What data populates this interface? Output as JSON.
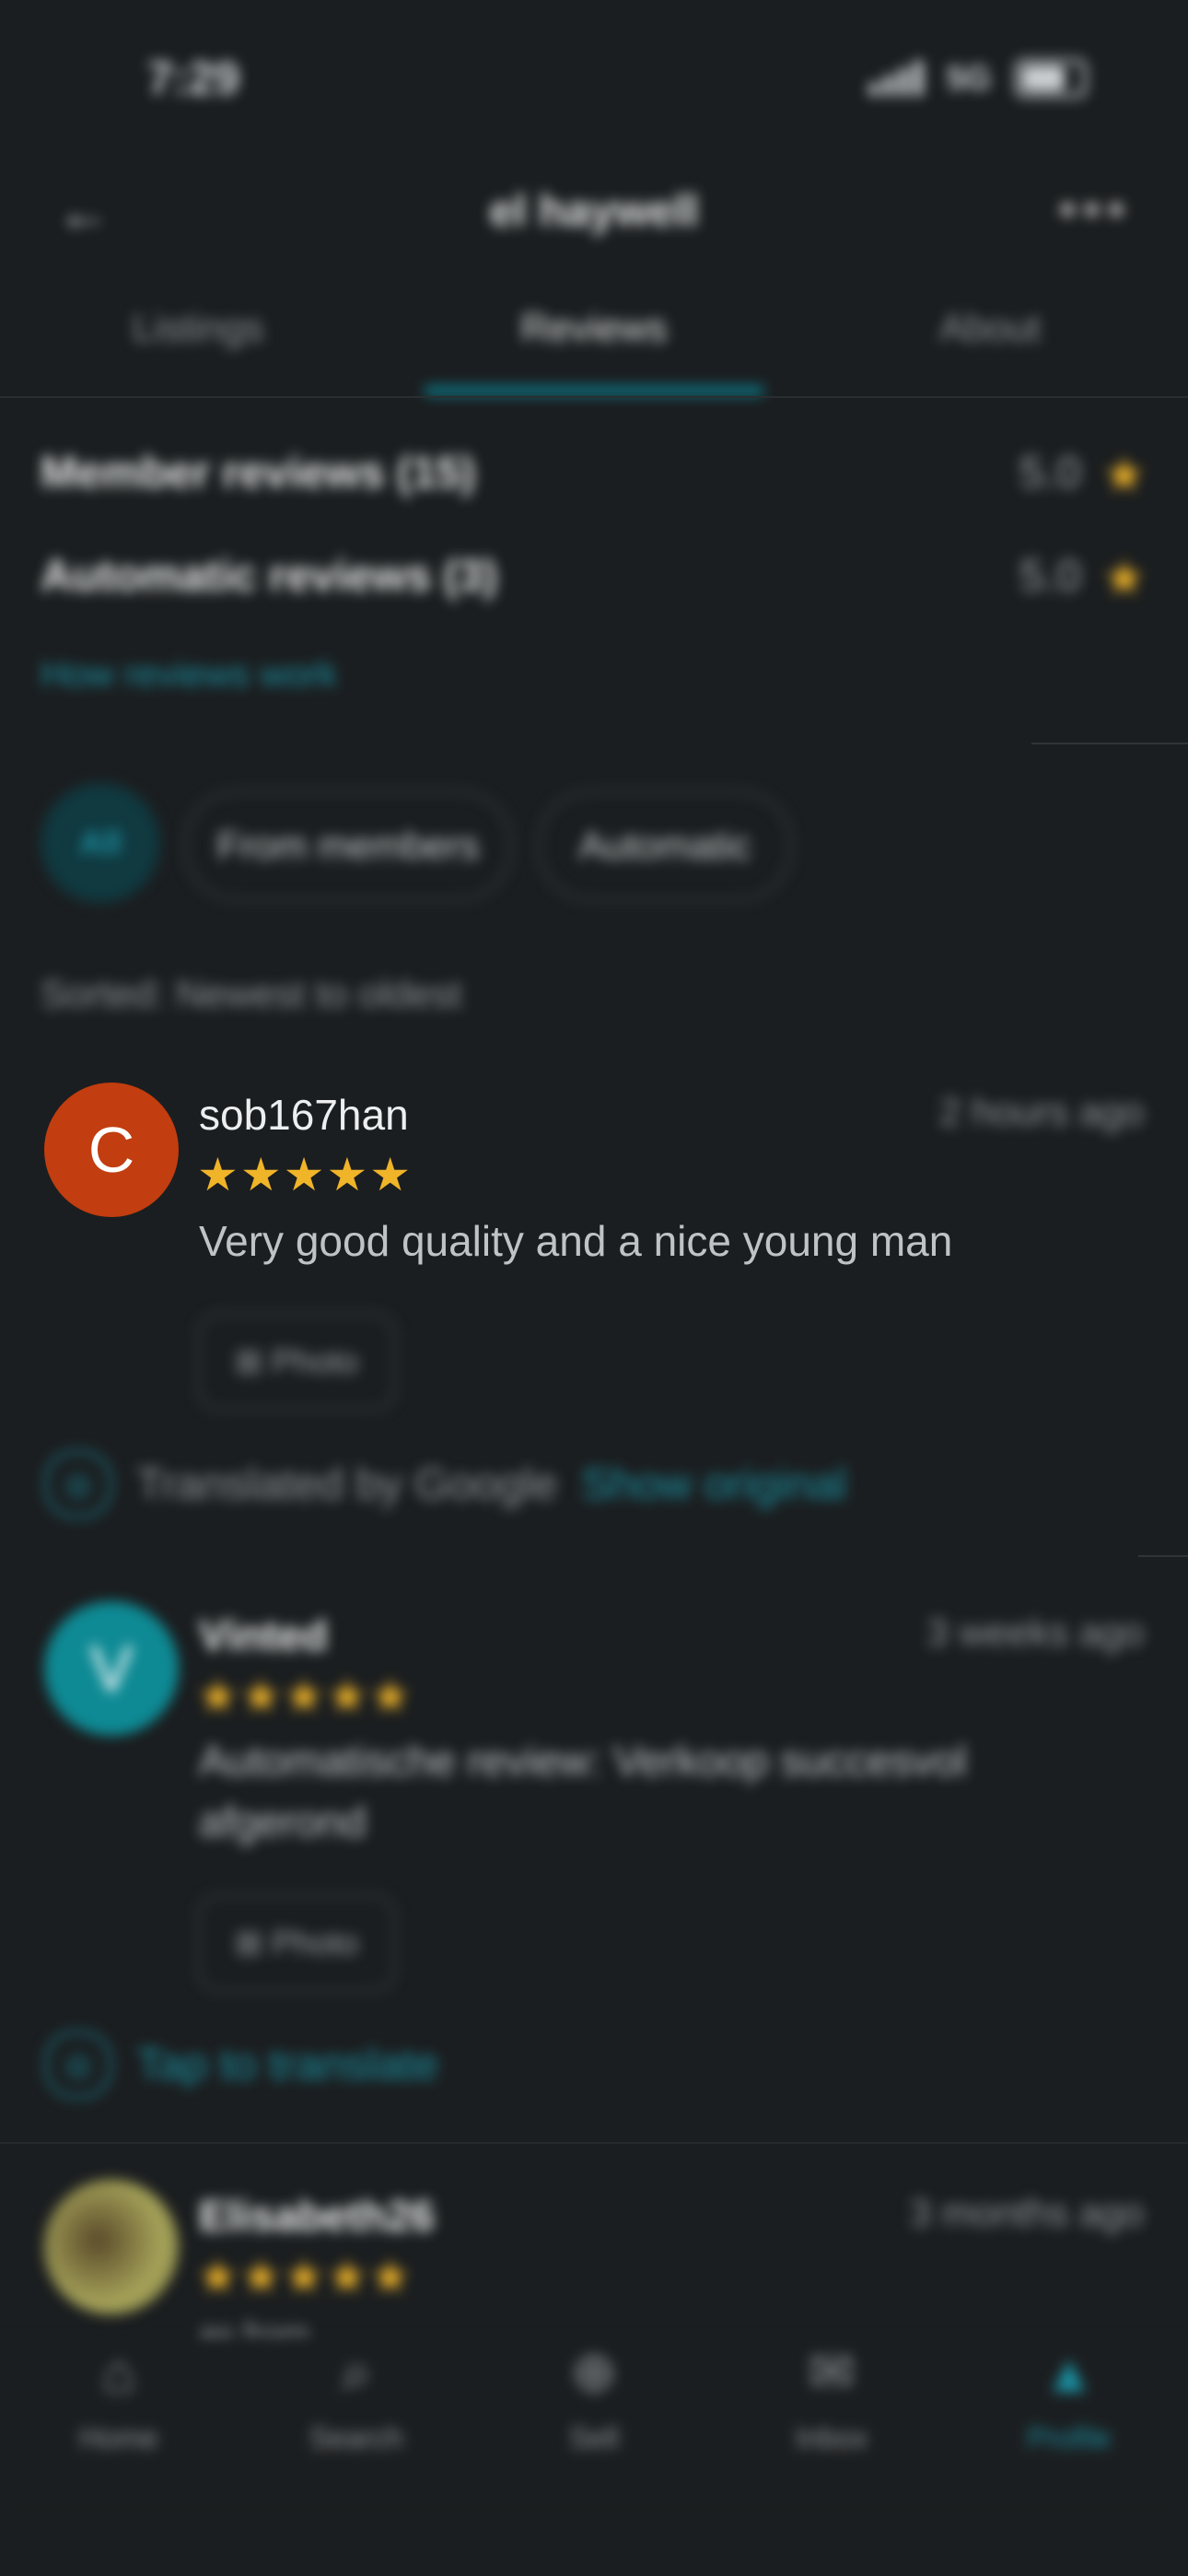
{
  "status": {
    "time": "7:29",
    "network": "5G"
  },
  "header": {
    "back_icon": "←",
    "title": "el haywell",
    "more_icon": "•••"
  },
  "tabs": [
    {
      "label": "Listings"
    },
    {
      "label": "Reviews"
    },
    {
      "label": "About"
    }
  ],
  "summary": {
    "member_label": "Member reviews (15)",
    "member_score": "5.0",
    "auto_label": "Automatic reviews (3)",
    "auto_score": "5.0",
    "link": "How reviews work"
  },
  "filters": {
    "all": "All",
    "from_members": "From members",
    "automatic": "Automatic"
  },
  "sort_label": "Sorted: Newest to oldest",
  "reviews": [
    {
      "avatar_letter": "C",
      "name": "sob167han",
      "time": "2 hours ago",
      "stars": "★★★★★",
      "text": "Very good quality and a nice young man",
      "photos": "⊞ Photo",
      "translated": "Translated by Google",
      "show_original": "Show original"
    },
    {
      "avatar_letter": "V",
      "name": "Vinted",
      "time": "3 weeks ago",
      "stars": "★★★★★",
      "text": "Automatische review: Verkoop succesvol afgerond",
      "photos": "⊞ Photo",
      "translate_link": "Tap to translate"
    },
    {
      "name": "Elisabeth26",
      "time": "3 months ago",
      "stars": "★★★★★",
      "text": "as from"
    }
  ],
  "nav": [
    {
      "label": "Home",
      "icon": "⌂"
    },
    {
      "label": "Search",
      "icon": "⌕"
    },
    {
      "label": "Sell",
      "icon": "⊕"
    },
    {
      "label": "Inbox",
      "icon": "✉"
    },
    {
      "label": "Profile",
      "icon": "▲"
    }
  ],
  "colors": {
    "accent": "#1b8fa0",
    "star": "#f0b429",
    "avatar_c": "#c23d0f",
    "avatar_v": "#0e8a94"
  }
}
